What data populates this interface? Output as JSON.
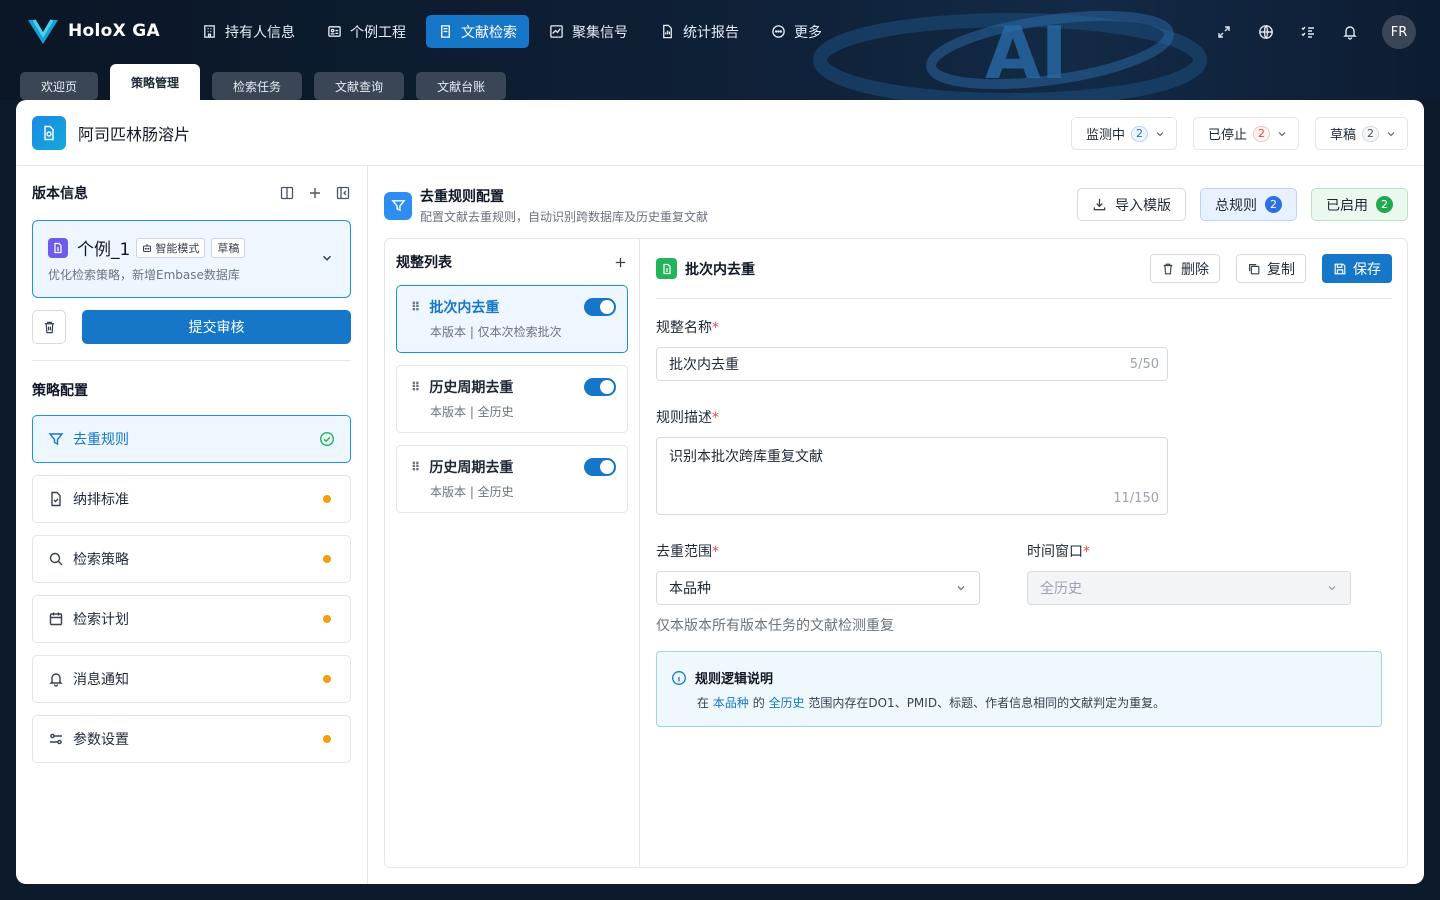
{
  "app": {
    "name": "HoloX GA"
  },
  "nav": [
    {
      "label": "持有人信息",
      "icon": "building-icon"
    },
    {
      "label": "个例工程",
      "icon": "id-card-icon"
    },
    {
      "label": "文献检索",
      "icon": "book-icon",
      "active": true
    },
    {
      "label": "聚集信号",
      "icon": "signal-icon"
    },
    {
      "label": "统计报告",
      "icon": "report-icon"
    },
    {
      "label": "更多",
      "icon": "more-icon"
    }
  ],
  "user": {
    "initials": "FR"
  },
  "tabs": [
    {
      "label": "欢迎页"
    },
    {
      "label": "策略管理",
      "active": true
    },
    {
      "label": "检索任务"
    },
    {
      "label": "文献查询"
    },
    {
      "label": "文献台账"
    }
  ],
  "product": {
    "title": "阿司匹林肠溶片"
  },
  "filters": [
    {
      "label": "监测中",
      "count": "2"
    },
    {
      "label": "已停止",
      "count": "2"
    },
    {
      "label": "草稿",
      "count": "2"
    }
  ],
  "version": {
    "section": "版本信息",
    "name": "个例_1",
    "mode": "智能模式",
    "status": "草稿",
    "desc": "优化检索策略，新增Embase数据库",
    "submit": "提交审核"
  },
  "strategy": {
    "section": "策略配置",
    "items": [
      {
        "label": "去重规则",
        "state": "done"
      },
      {
        "label": "纳排标准"
      },
      {
        "label": "检索策略"
      },
      {
        "label": "检索计划"
      },
      {
        "label": "消息通知"
      },
      {
        "label": "参数设置"
      }
    ]
  },
  "config": {
    "title": "去重规则配置",
    "subtitle": "配置文献去重规则，自动识别跨数据库及历史重复文献",
    "import": "导入模版",
    "total_label": "总规则",
    "total": "2",
    "enabled_label": "已启用",
    "enabled": "2"
  },
  "rules": {
    "title": "规整列表",
    "items": [
      {
        "name": "批次内去重",
        "sub": "本版本 | 仅本次检索批次",
        "enabled": true
      },
      {
        "name": "历史周期去重",
        "sub": "本版本 | 全历史",
        "enabled": true
      },
      {
        "name": "历史周期去重",
        "sub": "本版本 | 全历史",
        "enabled": true
      }
    ]
  },
  "detail": {
    "title": "批次内去重",
    "delete": "删除",
    "copy": "复制",
    "save": "保存",
    "name_label": "规整名称",
    "name_value": "批次内去重",
    "name_count": "5/50",
    "desc_label": "规则描述",
    "desc_value": "识别本批次跨库重复文献",
    "desc_count": "11/150",
    "scope_label": "去重范围",
    "scope_value": "本品种",
    "scope_hint": "仅本版本所有版本任务的文献检测重复",
    "window_label": "时间窗口",
    "window_value": "全历史",
    "info_title": "规则逻辑说明",
    "info_pre": "在",
    "info_scope": "本品种",
    "info_mid": "的",
    "info_window": "全历史",
    "info_post": "范围内存在DO1、PMID、标题、作者信息相同的文献判定为重复。"
  },
  "colors": {
    "primary": "#1677c8",
    "accent_bg": "#eef7ff",
    "warning": "#f59e0b",
    "success": "#22b35b"
  }
}
